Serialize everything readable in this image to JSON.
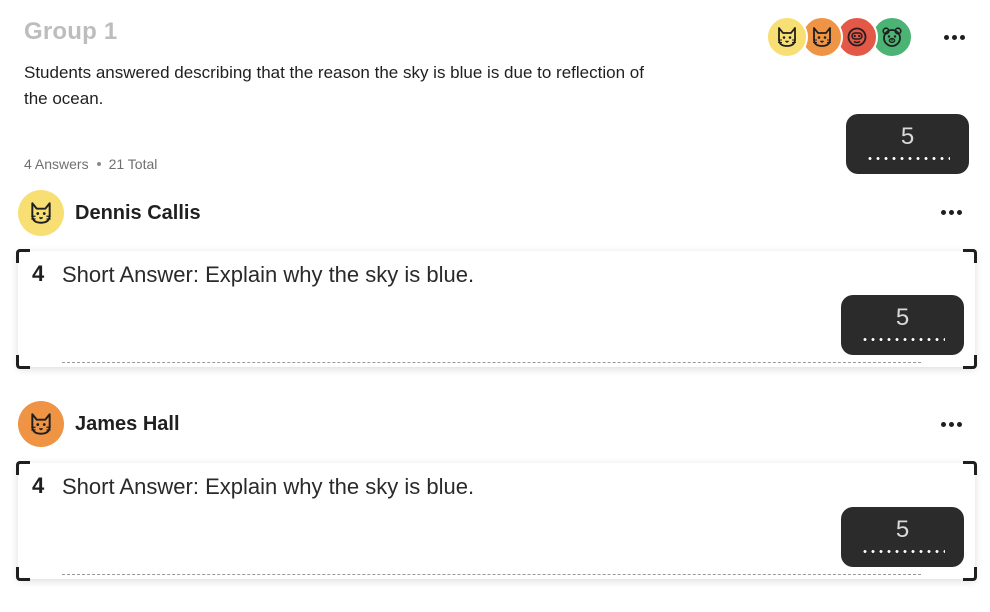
{
  "group": {
    "title": "Group 1",
    "description": "Students answered describing that the reason the sky is blue is due to reflection of the ocean.",
    "score": "5",
    "answers_count": "4 Answers",
    "total": "21 Total",
    "avatars": [
      {
        "icon": "cat-face-icon",
        "color": "#f7df73"
      },
      {
        "icon": "cat-face-icon",
        "color": "#ee9444"
      },
      {
        "icon": "monkey-face-icon",
        "color": "#e35847"
      },
      {
        "icon": "bear-face-icon",
        "color": "#4bb374"
      }
    ]
  },
  "students": [
    {
      "name": "Dennis Callis",
      "avatar_color": "#f7df73",
      "avatar_icon": "cat-face-icon",
      "question_number": "4",
      "question_text": "Short Answer: Explain why the sky is blue.",
      "score": "5"
    },
    {
      "name": "James Hall",
      "avatar_color": "#ee9444",
      "avatar_icon": "cat-face-icon",
      "question_number": "4",
      "question_text": "Short Answer: Explain why the sky is blue.",
      "score": "5"
    }
  ],
  "colors": {
    "score_box_bg": "#2b2b2b",
    "title_muted": "#bdbdbd"
  }
}
